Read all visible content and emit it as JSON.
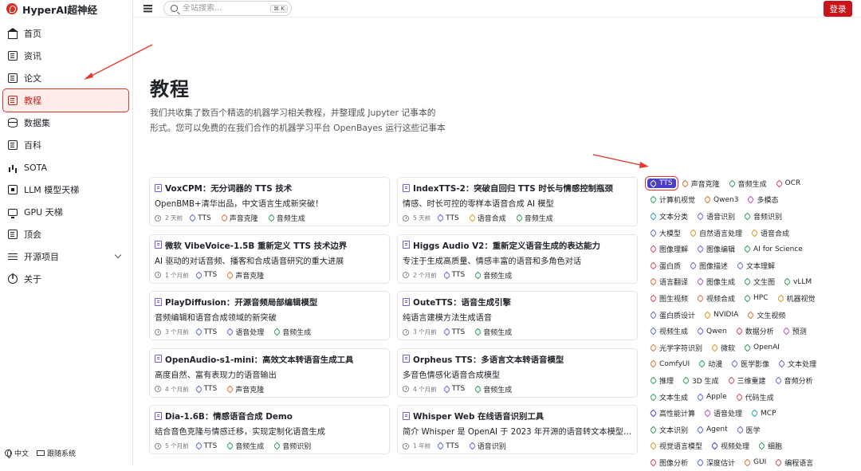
{
  "brand": {
    "name": "HyperAI超神经"
  },
  "nav": [
    {
      "label": "首页",
      "icon": "home-icon",
      "active": false
    },
    {
      "label": "资讯",
      "icon": "news-icon",
      "active": false
    },
    {
      "label": "论文",
      "icon": "paper-icon",
      "active": false
    },
    {
      "label": "教程",
      "icon": "tutorial-icon",
      "active": true
    },
    {
      "label": "数据集",
      "icon": "database-icon",
      "active": false
    },
    {
      "label": "百科",
      "icon": "wiki-icon",
      "active": false
    },
    {
      "label": "SOTA",
      "icon": "chart-icon",
      "active": false
    },
    {
      "label": "LLM 模型天梯",
      "icon": "chip-icon",
      "active": false
    },
    {
      "label": "GPU 天梯",
      "icon": "monitor-icon",
      "active": false
    },
    {
      "label": "顶会",
      "icon": "conference-icon",
      "active": false
    },
    {
      "label": "开源项目",
      "icon": "menu-icon",
      "active": false,
      "expandable": true
    },
    {
      "label": "关于",
      "icon": "info-icon",
      "active": false
    }
  ],
  "footer": {
    "language": "中文",
    "theme": "跟随系统"
  },
  "search": {
    "placeholder": "全站搜索...",
    "shortcut": "⌘ K"
  },
  "login_label": "登录",
  "page": {
    "title": "教程",
    "description_line1": "我们共收集了数百个精选的机器学习相关教程，并整理成 Jupyter 记事本的",
    "description_line2": "形式。您可以免费的在我们合作的机器学习平台 OpenBayes 运行这些记事本"
  },
  "cards": [
    {
      "title": "VoxCPM：无分词器的 TTS 技术",
      "desc": "OpenBMB+清华出品，中文语言生成新突破！",
      "time": "2 天前",
      "tags": [
        "TTS",
        "声音克隆",
        "音频生成"
      ]
    },
    {
      "title": "IndexTTS-2：突破自回归 TTS 时长与情感控制瓶颈",
      "desc": "情感、时长可控的零样本语音合成 AI 模型",
      "time": "5 天前",
      "tags": [
        "TTS",
        "语音合成",
        "音频生成"
      ]
    },
    {
      "title": "微软 VibeVoice-1.5B 重新定义 TTS 技术边界",
      "desc": "AI 驱动的对话音频、播客和合成语音研究的重大进展",
      "time": "1 个月前",
      "tags": [
        "TTS",
        "声音克隆"
      ]
    },
    {
      "title": "Higgs Audio V2：重新定义语音生成的表达能力",
      "desc": "专注于生成高质量、情感丰富的语音和多角色对话",
      "time": "2 个月前",
      "tags": [
        "TTS",
        "音频生成"
      ]
    },
    {
      "title": "PlayDiffusion：开源音频局部编辑模型",
      "desc": "音频编辑和语音合成领域的新突破",
      "time": "3 个月前",
      "tags": [
        "TTS",
        "语音处理",
        "音频生成"
      ]
    },
    {
      "title": "OuteTTS：语音生成引擎",
      "desc": "纯语言建模方法生成语音",
      "time": "3 个月前",
      "tags": [
        "TTS",
        "音频生成"
      ]
    },
    {
      "title": "OpenAudio-s1-mini：高效文本转语音生成工具",
      "desc": "高度自然、富有表现力的语音输出",
      "time": "4 个月前",
      "tags": [
        "TTS",
        "声音克隆"
      ]
    },
    {
      "title": "Orpheus TTS：多语言文本转语音模型",
      "desc": "多音色情感化语音合成模型",
      "time": "4 个月前",
      "tags": [
        "TTS",
        "音频生成"
      ]
    },
    {
      "title": "Dia-1.6B：情感语音合成 Demo",
      "desc": "结合音色克隆与情感迁移，实现定制化语音生成",
      "time": "5 个月前",
      "tags": [
        "TTS",
        "音频生成",
        "音频识别"
      ]
    },
    {
      "title": "Whisper Web 在线语音识别工具",
      "desc": "简介 Whisper 是 OpenAI 于 2023 年开源的语音转文本模型…",
      "time": "1 年前",
      "tags": [
        "TTS",
        "语音识别"
      ]
    }
  ],
  "tag_colors": {
    "TTS": "#5b6bd6",
    "声音克隆": "#e0733a",
    "音频生成": "#2f9e5a",
    "语音合成": "#d99a1e",
    "语音处理": "#7b5cd6",
    "音频识别": "#2f9e5a",
    "语音识别": "#5b6bd6"
  },
  "tag_cloud": [
    [
      {
        "label": "TTS",
        "color": "#4a3fc7",
        "active": true
      },
      {
        "label": "声音克隆",
        "color": "#e0733a"
      },
      {
        "label": "音频生成",
        "color": "#2f9e5a"
      },
      {
        "label": "OCR",
        "color": "#d9465a"
      }
    ],
    [
      {
        "label": "计算机视觉",
        "color": "#2f9e5a"
      },
      {
        "label": "Qwen3",
        "color": "#e0733a"
      },
      {
        "label": "多模态",
        "color": "#b34fc4"
      }
    ],
    [
      {
        "label": "文本分类",
        "color": "#2aa1b3"
      },
      {
        "label": "语音识别",
        "color": "#5b6bd6"
      },
      {
        "label": "音频识别",
        "color": "#2f9e5a"
      }
    ],
    [
      {
        "label": "大模型",
        "color": "#5b6bd6"
      },
      {
        "label": "自然语言处理",
        "color": "#d99a1e"
      },
      {
        "label": "语音合成",
        "color": "#d99a1e"
      }
    ],
    [
      {
        "label": "图像理解",
        "color": "#d9465a"
      },
      {
        "label": "图像编辑",
        "color": "#5b6bd6"
      },
      {
        "label": "AI for Science",
        "color": "#2f9e5a"
      }
    ],
    [
      {
        "label": "蛋白质",
        "color": "#d9465a"
      },
      {
        "label": "图像描述",
        "color": "#7b5cd6"
      },
      {
        "label": "文本理解",
        "color": "#5b6bd6"
      }
    ],
    [
      {
        "label": "语言翻译",
        "color": "#e0733a"
      },
      {
        "label": "图像生成",
        "color": "#b34fc4"
      },
      {
        "label": "文生图",
        "color": "#2f9e5a"
      },
      {
        "label": "vLLM",
        "color": "#2f9e5a"
      }
    ],
    [
      {
        "label": "图生视频",
        "color": "#d9465a"
      },
      {
        "label": "视频合成",
        "color": "#e0733a"
      },
      {
        "label": "HPC",
        "color": "#2f9e5a"
      },
      {
        "label": "机器视觉",
        "color": "#d99a1e"
      }
    ],
    [
      {
        "label": "蛋白质设计",
        "color": "#5b6bd6"
      },
      {
        "label": "NVIDIA",
        "color": "#d99a1e"
      },
      {
        "label": "文生视频",
        "color": "#e0733a"
      }
    ],
    [
      {
        "label": "视频生成",
        "color": "#5b6bd6"
      },
      {
        "label": "Qwen",
        "color": "#5b6bd6"
      },
      {
        "label": "数据分析",
        "color": "#d9465a"
      },
      {
        "label": "预测",
        "color": "#b34fc4"
      }
    ],
    [
      {
        "label": "光学字符识别",
        "color": "#e0733a"
      },
      {
        "label": "微软",
        "color": "#d99a1e"
      },
      {
        "label": "OpenAI",
        "color": "#2f9e5a"
      }
    ],
    [
      {
        "label": "ComfyUI",
        "color": "#e0733a"
      },
      {
        "label": "动漫",
        "color": "#2f9e5a"
      },
      {
        "label": "医学影像",
        "color": "#5b6bd6"
      },
      {
        "label": "文本处理",
        "color": "#7b5cd6"
      }
    ],
    [
      {
        "label": "推理",
        "color": "#2f9e5a"
      },
      {
        "label": "3D 生成",
        "color": "#2f9e5a"
      },
      {
        "label": "三维重建",
        "color": "#d9465a"
      },
      {
        "label": "音频分析",
        "color": "#5b6bd6"
      }
    ],
    [
      {
        "label": "文本生成",
        "color": "#2f9e5a"
      },
      {
        "label": "Apple",
        "color": "#5b6bd6"
      },
      {
        "label": "代码生成",
        "color": "#d9465a"
      }
    ],
    [
      {
        "label": "高性能计算",
        "color": "#4a3fc7"
      },
      {
        "label": "语音处理",
        "color": "#b34fc4"
      },
      {
        "label": "MCP",
        "color": "#2aa1b3"
      }
    ],
    [
      {
        "label": "文本识别",
        "color": "#2f9e5a"
      },
      {
        "label": "Agent",
        "color": "#5b6bd6"
      },
      {
        "label": "医学",
        "color": "#7b5cd6"
      }
    ],
    [
      {
        "label": "视觉语言模型",
        "color": "#d99a1e"
      },
      {
        "label": "视频处理",
        "color": "#4a3fc7"
      },
      {
        "label": "细胞",
        "color": "#2f9e5a"
      }
    ],
    [
      {
        "label": "图像分析",
        "color": "#d9465a"
      },
      {
        "label": "深度估计",
        "color": "#5b6bd6"
      },
      {
        "label": "GUI",
        "color": "#e0733a"
      },
      {
        "label": "编程语言",
        "color": "#d9465a"
      }
    ]
  ]
}
